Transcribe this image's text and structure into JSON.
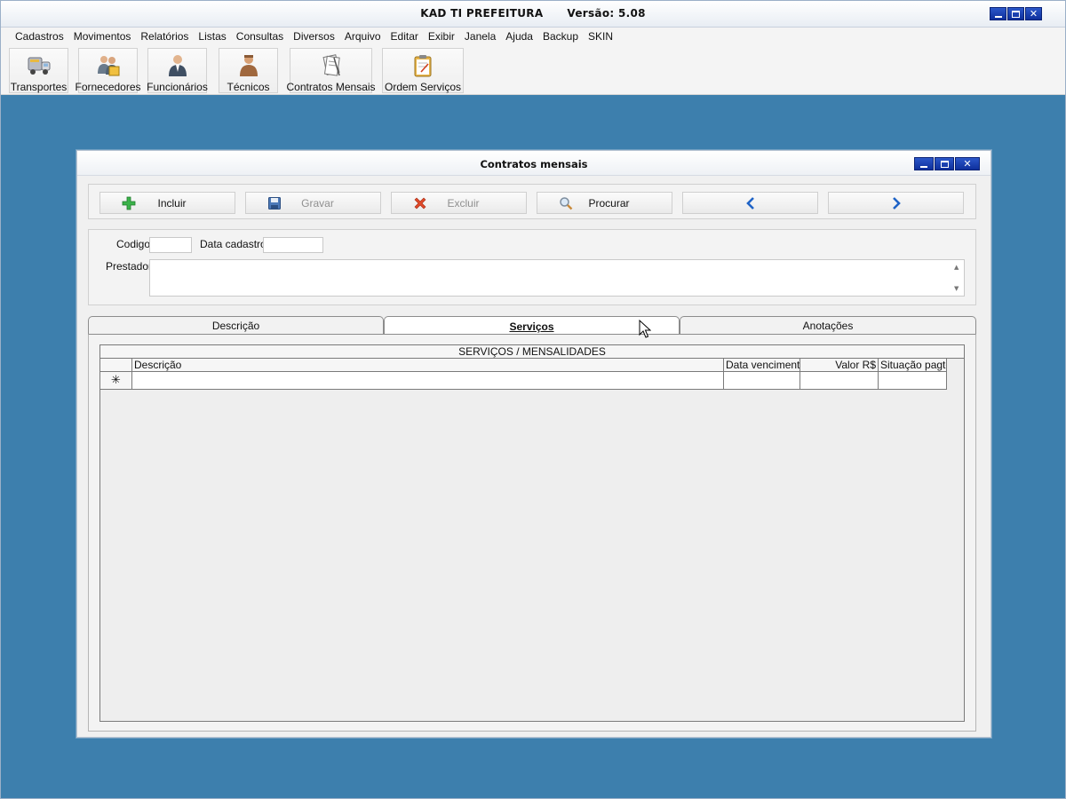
{
  "app": {
    "title": "KAD TI PREFEITURA",
    "version_label": "Versão: 5.08"
  },
  "menu": [
    "Cadastros",
    "Movimentos",
    "Relatórios",
    "Listas",
    "Consultas",
    "Diversos",
    "Arquivo",
    "Editar",
    "Exibir",
    "Janela",
    "Ajuda",
    "Backup",
    "SKIN"
  ],
  "toolbar": {
    "transportes": "Transportes",
    "fornecedores": "Fornecedores",
    "funcionarios": "Funcionários",
    "tecnicos": "Técnicos",
    "contratos": "Contratos Mensais",
    "ordem": "Ordem Serviços"
  },
  "child_window": {
    "title": "Contratos mensais"
  },
  "actions": {
    "incluir": "Incluir",
    "gravar": "Gravar",
    "excluir": "Excluir",
    "procurar": "Procurar"
  },
  "form": {
    "codigo_label": "Codigo",
    "codigo_value": "",
    "data_cadastro_label": "Data cadastro",
    "data_cadastro_value": "",
    "prestador_label": "Prestador",
    "prestador_value": ""
  },
  "tabs": {
    "descricao": "Descrição",
    "servicos": "Serviços",
    "anotacoes": "Anotações"
  },
  "grid": {
    "caption": "SERVIÇOS / MENSALIDADES",
    "columns": {
      "descricao": "Descrição",
      "data_vencimento": "Data vencimento",
      "valor": "Valor R$",
      "situacao": "Situação pagto"
    },
    "new_row_marker": "✳"
  },
  "colors": {
    "desktop": "#3d7fad",
    "window_button": "#1a3fb0",
    "add_green": "#3bb34a",
    "delete_red": "#e04a2a",
    "nav_blue": "#1f63c6"
  }
}
